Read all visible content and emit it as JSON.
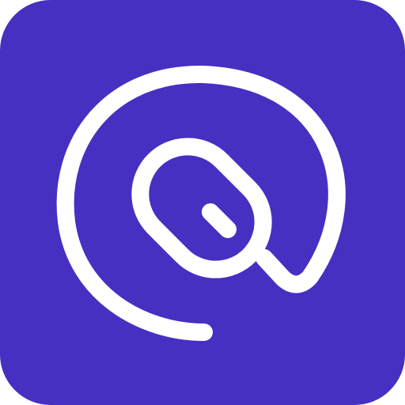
{
  "icon": {
    "background_color": "#4530C2",
    "stroke_color": "#FFFFFF",
    "symbol": "mouse-with-cable-icon"
  }
}
